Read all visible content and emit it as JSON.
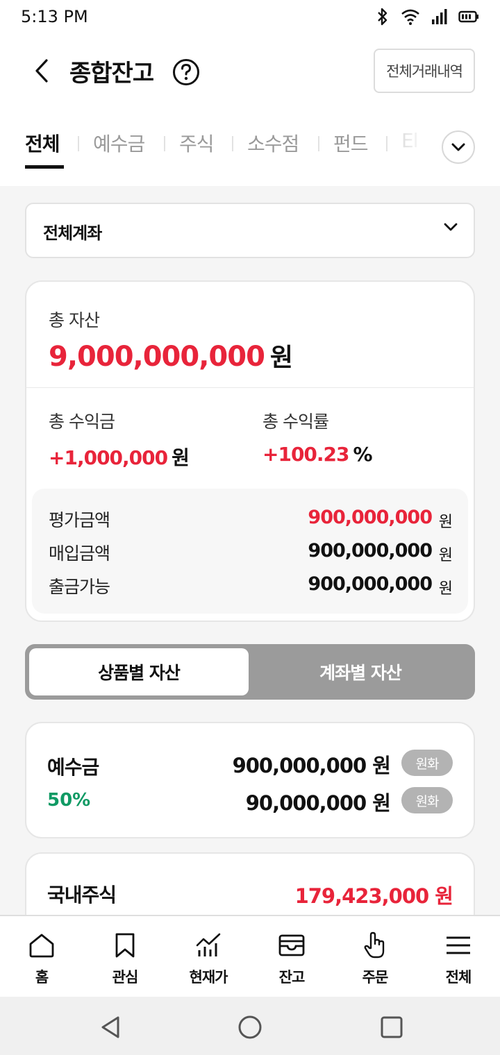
{
  "status_bar": {
    "time": "5:13 PM",
    "icons": [
      "bluetooth-icon",
      "wifi-icon",
      "signal-icon",
      "battery-icon"
    ]
  },
  "header": {
    "title": "종합잔고",
    "history_button": "전체거래내역"
  },
  "tabs": [
    {
      "label": "전체",
      "active": true
    },
    {
      "label": "예수금",
      "active": false
    },
    {
      "label": "주식",
      "active": false
    },
    {
      "label": "소수점",
      "active": false
    },
    {
      "label": "펀드",
      "active": false
    },
    {
      "label": "El",
      "active": false
    }
  ],
  "account_select": {
    "selected": "전체계좌"
  },
  "summary": {
    "total_label": "총 자산",
    "total_value": "9,000,000,000",
    "total_unit": "원",
    "profit_label": "총 수익금",
    "profit_value": "+1,000,000",
    "profit_unit": "원",
    "rate_label": "총 수익률",
    "rate_value": "+100.23",
    "rate_unit": "%",
    "details": [
      {
        "label": "평가금액",
        "value": "900,000,000",
        "unit": "원"
      },
      {
        "label": "매입금액",
        "value": "900,000,000",
        "unit": "원"
      },
      {
        "label": "출금가능",
        "value": "900,000,000",
        "unit": "원"
      }
    ]
  },
  "segment": {
    "active": "상품별 자산",
    "inactive": "계좌별 자산"
  },
  "deposit_card": {
    "title": "예수금",
    "percent": "50%",
    "row1_amount": "900,000,000 원",
    "row1_badge": "원화",
    "row2_amount": "90,000,000 원",
    "row2_badge": "원화"
  },
  "stock_card": {
    "title": "국내주식",
    "value": "179,423,000 원"
  },
  "bottom_nav": [
    {
      "label": "홈",
      "icon": "home-icon"
    },
    {
      "label": "관심",
      "icon": "bookmark-icon"
    },
    {
      "label": "현재가",
      "icon": "chart-icon"
    },
    {
      "label": "잔고",
      "icon": "wallet-icon"
    },
    {
      "label": "주문",
      "icon": "hand-pointer-icon"
    },
    {
      "label": "전체",
      "icon": "menu-icon"
    }
  ],
  "colors": {
    "accent_red": "#e8243a",
    "accent_green": "#0f9a64",
    "segment_bg": "#9b9b9b"
  }
}
